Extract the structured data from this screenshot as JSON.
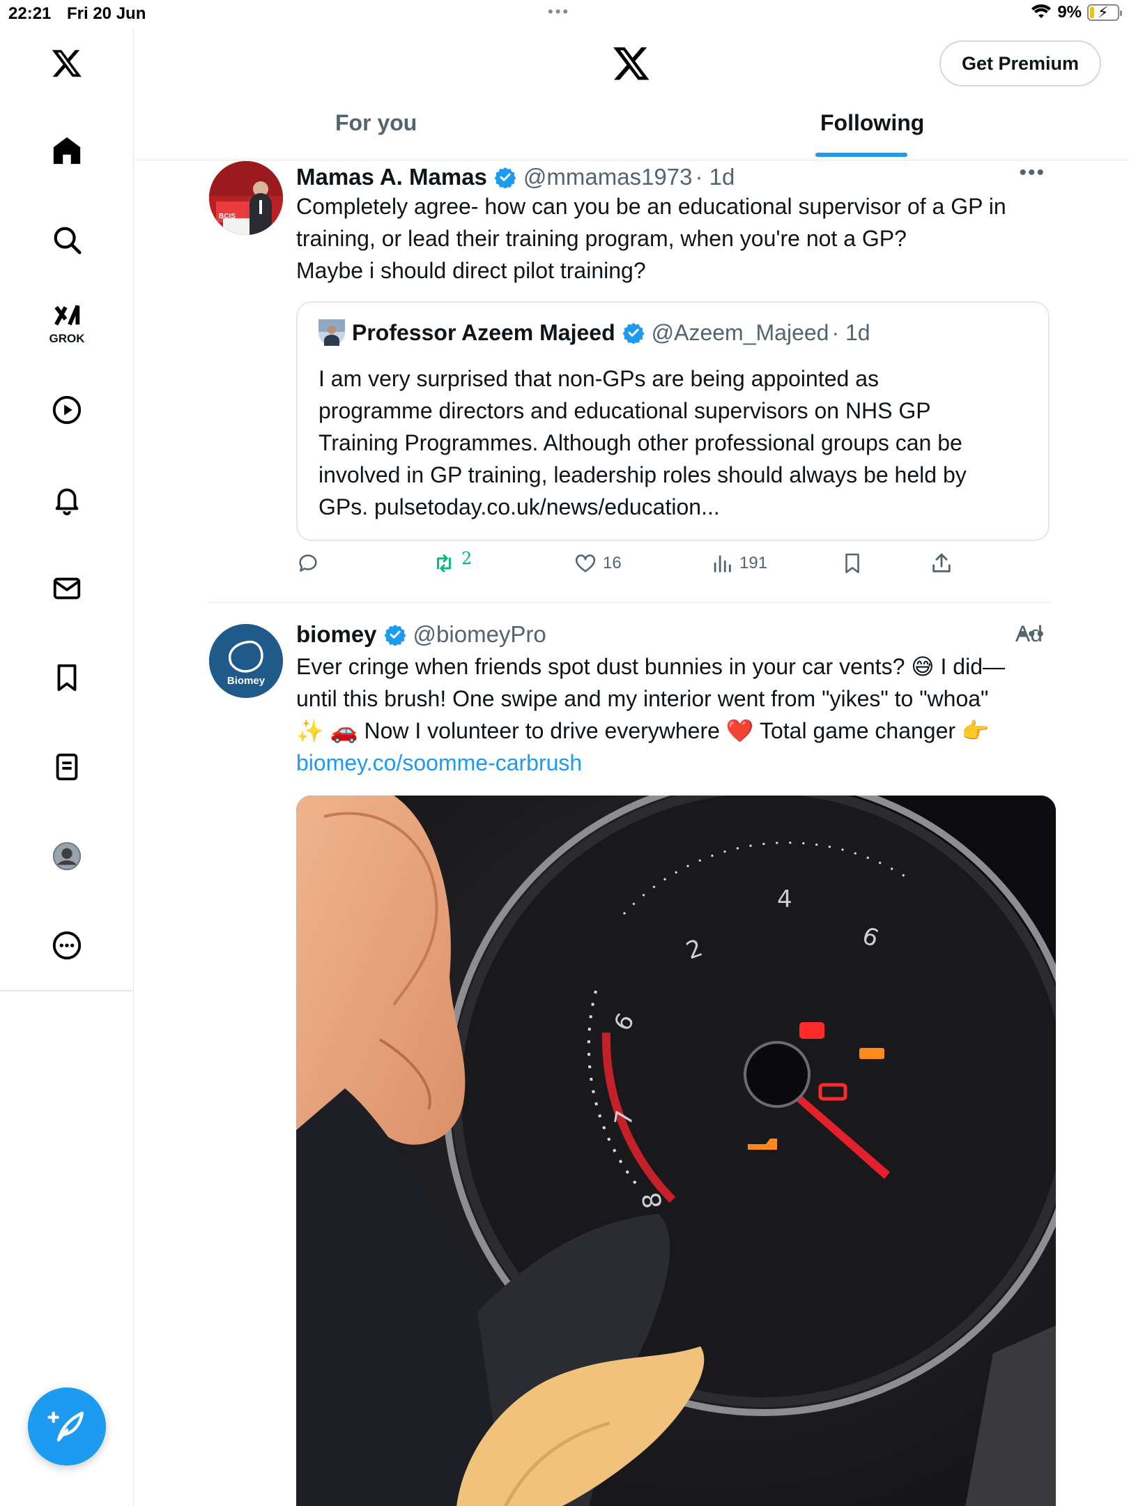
{
  "status": {
    "time": "22:21",
    "date": "Fri 20 Jun",
    "battery": "9%"
  },
  "header": {
    "premium_label": "Get Premium",
    "tabs": [
      {
        "label": "For you"
      },
      {
        "label": "Following"
      }
    ]
  },
  "sidebar": {
    "grok_label": "GROK"
  },
  "tweets": [
    {
      "name": "Mamas A. Mamas",
      "handle": "@mmamas1973",
      "time": "· 1d",
      "text": [
        "Completely agree- how can you be an educational supervisor of a GP in",
        "training, or lead their training program, when you're not a GP?",
        "Maybe i should direct pilot training?"
      ],
      "quote": {
        "name": "Professor Azeem Majeed",
        "handle": "@Azeem_Majeed",
        "time": "· 1d",
        "text": [
          "I am very surprised that non-GPs are being appointed as",
          "programme directors and educational supervisors on NHS GP",
          "Training Programmes. Although other professional groups can be",
          "involved in GP training, leadership roles should always be held by",
          "GPs. pulsetoday.co.uk/news/education..."
        ]
      },
      "stats": {
        "retweets": "2",
        "likes": "16",
        "views": "191"
      }
    },
    {
      "name": "biomey",
      "handle": "@biomeyPro",
      "ad_label": "Ad",
      "avatar_text": "Biomey",
      "text": [
        "Ever cringe when friends spot dust bunnies in your car vents? 😅 I did—",
        "until this brush! One swipe and my interior went from \"yikes\" to \"whoa\"",
        "✨ 🚗 Now I volunteer to drive everywhere ❤️ Total game changer 👉"
      ],
      "link": "biomey.co/soomme-carbrush"
    }
  ],
  "gauge_numbers": [
    "2",
    "4",
    "6",
    "6",
    "7",
    "8"
  ],
  "colors": {
    "accent": "#1d9bf0",
    "retweet": "#00ba7c",
    "muted": "#536471"
  }
}
